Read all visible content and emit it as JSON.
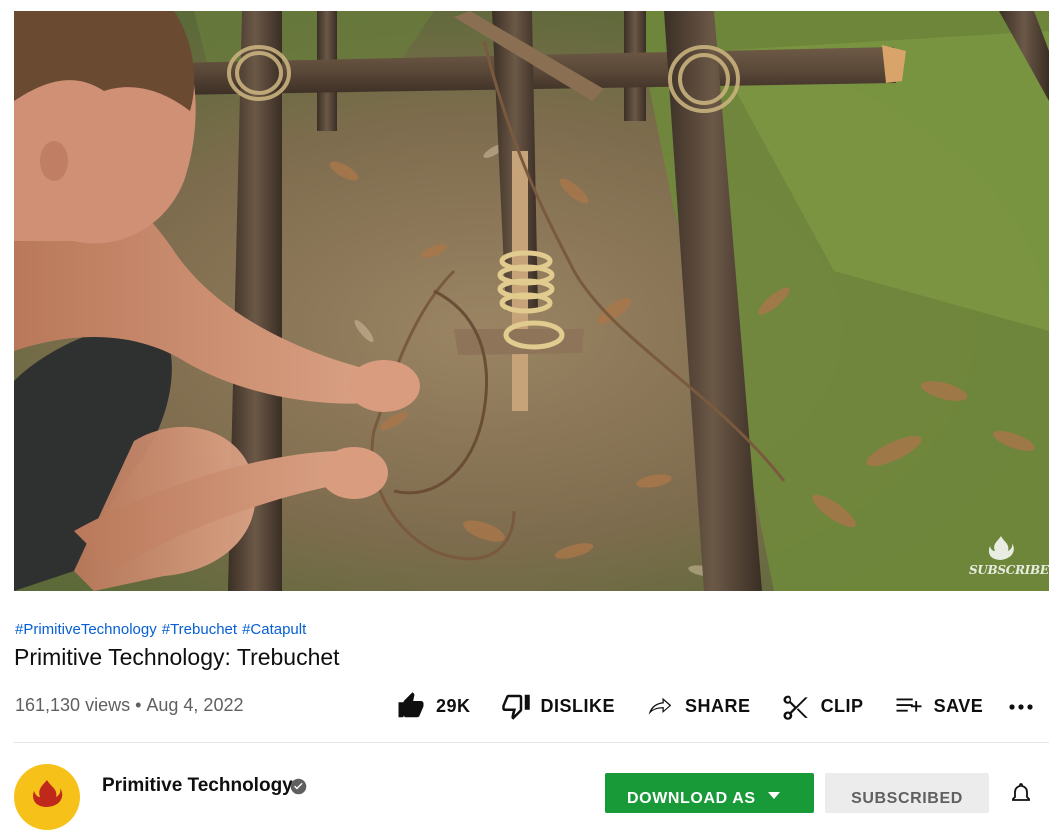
{
  "video": {
    "watermark_label": "SUBSCRIBE"
  },
  "hashtags": [
    "#PrimitiveTechnology",
    "#Trebuchet",
    "#Catapult"
  ],
  "title": "Primitive Technology: Trebuchet",
  "stats": {
    "views": "161,130 views",
    "separator": "•",
    "date": "Aug 4, 2022"
  },
  "actions": {
    "like": {
      "label": "29K",
      "icon": "thumbs-up-icon"
    },
    "dislike": {
      "label": "DISLIKE",
      "icon": "thumbs-down-icon"
    },
    "share": {
      "label": "SHARE",
      "icon": "share-icon"
    },
    "clip": {
      "label": "CLIP",
      "icon": "scissors-icon"
    },
    "save": {
      "label": "SAVE",
      "icon": "playlist-add-icon"
    },
    "more": {
      "icon": "more-horizontal-icon"
    }
  },
  "channel": {
    "name": "Primitive Technology",
    "verified_icon": "verified-check-icon",
    "download_label": "DOWNLOAD AS",
    "subscribed_label": "SUBSCRIBED",
    "bell_icon": "bell-icon"
  },
  "colors": {
    "link": "#065fd4",
    "download_green": "#189a39",
    "avatar_yellow": "#f6c21a",
    "avatar_red": "#c0281c"
  }
}
